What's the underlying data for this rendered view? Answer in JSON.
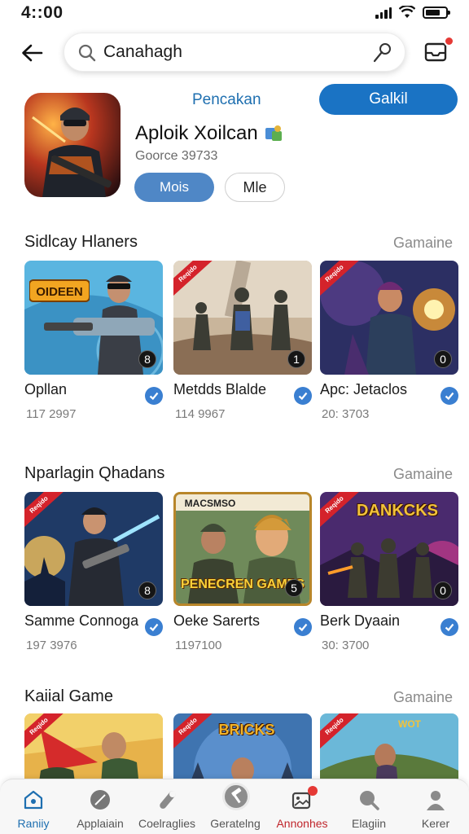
{
  "status_bar": {
    "time": "4::00"
  },
  "search": {
    "value": "Canahagh"
  },
  "featured": {
    "tag": "Pencakan",
    "primary_button": "Galkil",
    "title": "Aploik Xoilcan",
    "subtitle": "Goorce 39733",
    "more_button": "Mois",
    "secondary_button": "Mle"
  },
  "sections": [
    {
      "title": "Sidlcay Hlaners",
      "more": "Gamaine",
      "cards": [
        {
          "name": "Opllan",
          "count": "117 2997",
          "rank": "8",
          "logo": "OIDEEN"
        },
        {
          "name": "Metdds Blalde",
          "count": "114 9967",
          "rank": "1",
          "ribbon": "Reqido"
        },
        {
          "name": "Apc: Jetaclos",
          "count": "20: 3703",
          "rank": "0",
          "ribbon": "Reqido"
        }
      ]
    },
    {
      "title": "Nparlagin Qhadans",
      "more": "Gamaine",
      "cards": [
        {
          "name": "Samme Connoga",
          "count": "197 3976",
          "rank": "8",
          "ribbon": "Reqido"
        },
        {
          "name": "Oeke Sarerts",
          "count": "1197100",
          "rank": "5",
          "logo": "PENECREN GAMES",
          "banner": "MACSMSO"
        },
        {
          "name": "Berk Dyaain",
          "count": "30: 3700",
          "rank": "0",
          "ribbon": "Reqido",
          "logo": "DANKCKS"
        }
      ]
    },
    {
      "title": "Kaiial Game",
      "more": "Gamaine",
      "cards": [
        {
          "ribbon": "Reqido"
        },
        {
          "ribbon": "Reqido",
          "logo": "BRICKS"
        },
        {
          "ribbon": "Reqido",
          "logo": "WOT"
        }
      ]
    }
  ],
  "bottom_nav": [
    {
      "label": "Raniiy",
      "icon": "home-icon",
      "state": "active"
    },
    {
      "label": "Applaiain",
      "icon": "feather-icon"
    },
    {
      "label": "Coelraglies",
      "icon": "wrench-icon"
    },
    {
      "label": "Geratelng",
      "icon": "hammer-icon"
    },
    {
      "label": "Annonhes",
      "icon": "image-badge-icon",
      "state": "alert"
    },
    {
      "label": "Elagiin",
      "icon": "search-icon"
    },
    {
      "label": "Kerer",
      "icon": "person-icon"
    }
  ],
  "colors": {
    "accent": "#1a73c4",
    "verified": "#3a7fd1",
    "ribbon": "#d4232b",
    "alert": "#e53935"
  }
}
